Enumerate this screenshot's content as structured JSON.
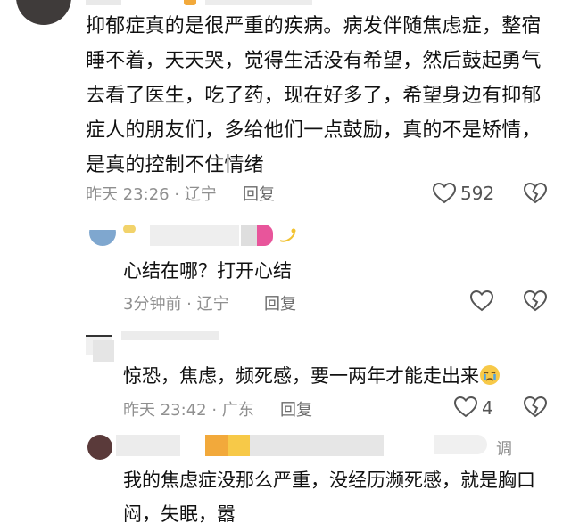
{
  "comments": [
    {
      "text": "抑郁症真的是很严重的疾病。病发伴随焦虑症，整宿睡不着，天天哭，觉得生活没有希望，然后鼓起勇气去看了医生，吃了药，现在好多了，希望身边有抑郁症人的朋友们，多给他们一点鼓励，真的不是矫情，是真的控制不住情绪",
      "time_location": "昨天 23:26 · 辽宁",
      "reply_label": "回复",
      "likes": "592"
    },
    {
      "text": "心结在哪？打开心结",
      "time_location": "3分钟前 · 辽宁",
      "reply_label": "回复",
      "likes": ""
    },
    {
      "text": "惊恐，焦虑，频死感，要一两年才能走出来",
      "time_location": "昨天 23:42 · 广东",
      "reply_label": "回复",
      "likes": "4"
    },
    {
      "text": "我的焦虑症没那么严重，没经历濒死感，就是胸口闷，失眠，嚣",
      "partial_right_label": "调"
    }
  ],
  "icons": {
    "like": "heart-outline-icon",
    "dislike": "broken-heart-icon",
    "crying_emoji": "crying-face-emoji",
    "sparkle_emoji": "dizzy-sparkle-emoji"
  },
  "colors": {
    "meta_text": "#8f8f8f",
    "icon_stroke": "#555555",
    "pink_blur": "#e8559b",
    "orange_blur": "#f2a93b",
    "yellow_blur": "#f7c948"
  }
}
